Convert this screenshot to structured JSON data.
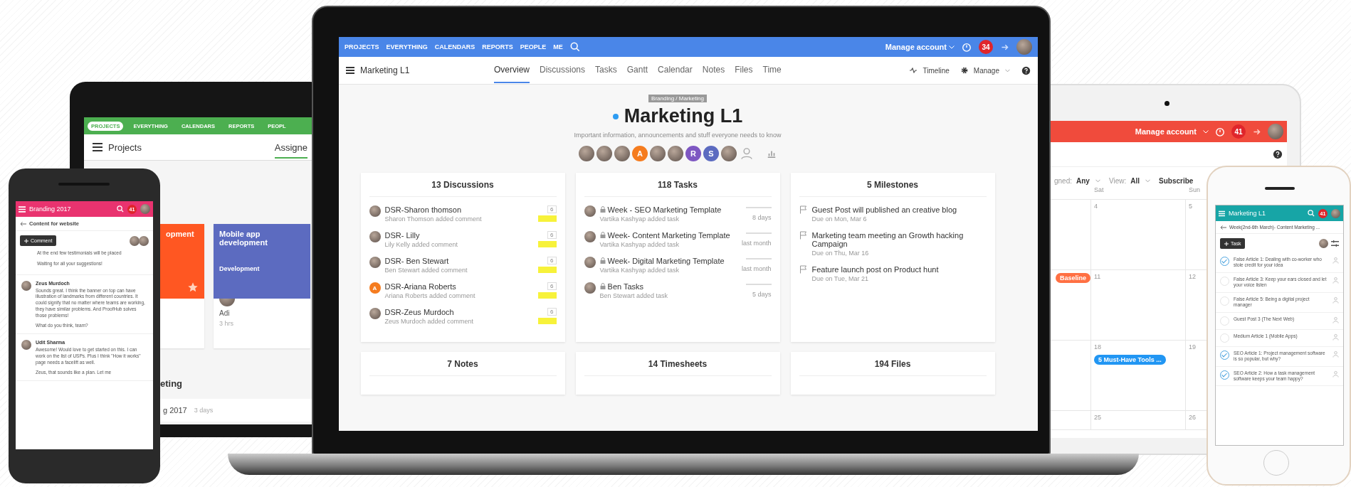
{
  "laptop": {
    "top_nav": [
      {
        "label": "PROJECTS"
      },
      {
        "label": "EVERYTHING"
      },
      {
        "label": "CALENDARS"
      },
      {
        "label": "REPORTS"
      },
      {
        "label": "PEOPLE"
      },
      {
        "label": "ME"
      }
    ],
    "account_menu": "Manage account",
    "notification_count": "34",
    "project_title": "Marketing L1",
    "tabs": [
      {
        "label": "Overview",
        "selected": true
      },
      {
        "label": "Discussions",
        "selected": false
      },
      {
        "label": "Tasks",
        "selected": false
      },
      {
        "label": "Gantt",
        "selected": false
      },
      {
        "label": "Calendar",
        "selected": false
      },
      {
        "label": "Notes",
        "selected": false
      },
      {
        "label": "Files",
        "selected": false
      },
      {
        "label": "Time",
        "selected": false
      }
    ],
    "timeline": "Timeline",
    "manage": "Manage",
    "breadcrumb": "Branding / Marketing",
    "title": "Marketing L1",
    "subtitle": "Important information, announcements and stuff everyone needs to know",
    "members": [
      {
        "kind": "photo"
      },
      {
        "kind": "photo"
      },
      {
        "kind": "photo"
      },
      {
        "kind": "letter",
        "letter": "A",
        "color": "#f57c1f"
      },
      {
        "kind": "photo"
      },
      {
        "kind": "photo"
      },
      {
        "kind": "letter",
        "letter": "R",
        "color": "#7e57c2"
      },
      {
        "kind": "letter",
        "letter": "S",
        "color": "#5c6bc0"
      },
      {
        "kind": "photo"
      },
      {
        "kind": "add"
      }
    ],
    "panels": [
      {
        "kind": "discussions",
        "title": "13 Discussions",
        "items": [
          {
            "name": "DSR-Sharon thomson",
            "activity": "Sharon Thomson added comment",
            "count": "6",
            "highlighted": true,
            "avatar": {
              "kind": "photo"
            }
          },
          {
            "name": "DSR- Lilly",
            "activity": "Lily Kelly added comment",
            "count": "6",
            "highlighted": true,
            "avatar": {
              "kind": "photo"
            }
          },
          {
            "name": "DSR- Ben Stewart",
            "activity": "Ben Stewart added comment",
            "count": "6",
            "highlighted": true,
            "avatar": {
              "kind": "photo"
            }
          },
          {
            "name": "DSR-Ariana Roberts",
            "activity": "Ariana Roberts added comment",
            "count": "6",
            "highlighted": true,
            "avatar": {
              "kind": "letter",
              "letter": "A",
              "color": "#f57c1f"
            }
          },
          {
            "name": "DSR-Zeus Murdoch",
            "activity": "Zeus Murdoch added comment",
            "count": "6",
            "highlighted": true,
            "avatar": {
              "kind": "photo"
            }
          }
        ]
      },
      {
        "kind": "tasks",
        "title": "118 Tasks",
        "items": [
          {
            "title": "Week - SEO Marketing Template",
            "activity": "Vartika Kashyap added task",
            "time": "8 days"
          },
          {
            "title": "Week- Content Marketing Template",
            "activity": "Vartika Kashyap added task",
            "time": "last month"
          },
          {
            "title": "Week- Digital Marketing Template",
            "activity": "Vartika Kashyap added task",
            "time": "last month"
          },
          {
            "title": "Ben Tasks",
            "activity": "Ben Stewart added task",
            "time": "5 days"
          }
        ]
      },
      {
        "kind": "milestones",
        "title": "5 Milestones",
        "items": [
          {
            "title": "Guest Post will published an creative blog",
            "due": "Due on Mon, Mar 6"
          },
          {
            "title": "Marketing team meeting an Growth hacking Campaign",
            "due": "Due on Thu, Mar 16"
          },
          {
            "title": "Feature launch post on Product hunt",
            "due": "Due on Tue, Mar 21"
          }
        ]
      }
    ],
    "more_panels": [
      {
        "title": "7 Notes"
      },
      {
        "title": "14 Timesheets"
      },
      {
        "title": "194 Files"
      }
    ]
  },
  "left_tablet": {
    "nav": [
      {
        "label": "PROJECTS",
        "selected": true
      },
      {
        "label": "EVERYTHING",
        "selected": false
      },
      {
        "label": "CALENDARS",
        "selected": false
      },
      {
        "label": "REPORTS",
        "selected": false
      },
      {
        "label": "PEOPL",
        "selected": false
      }
    ],
    "title": "Projects",
    "view_tab": "Assigne",
    "cards": [
      {
        "title": "opment",
        "color": "#ff5722",
        "starred": true
      },
      {
        "title": "Mobile app development",
        "color": "#5c6bc0",
        "starred": false,
        "tag": "Development",
        "assignee": "Adi",
        "time": "3 hrs"
      }
    ],
    "section_title": "eting",
    "row": {
      "name": "g 2017",
      "time": "3 days"
    }
  },
  "left_phone": {
    "title": "Branding 2017",
    "notification_count": "41",
    "back_title": "Content for website",
    "comment_button": "Comment",
    "intro": [
      "At the end few testimonials will be placed",
      "Waiting for all your suggestions!"
    ],
    "comments": [
      {
        "author": "Zeus Murdoch",
        "paragraphs": [
          "Sounds great. I think the banner on top can have illustration of landmarks from different countries. It could signify that no matter where teams are working, they have similar problems. And ProofHub solves those problems!",
          "What do you think, team?"
        ]
      },
      {
        "author": "Udit Sharma",
        "paragraphs": [
          "Awesome! Would love to get started on this. I can work on the list of USPs. Plus I think \"How it works\" page needs a facelift as well.",
          "Zeus, that sounds like a plan. Let me"
        ]
      }
    ]
  },
  "right_tablet": {
    "account_menu": "Manage account",
    "notification_count": "41",
    "filters": [
      {
        "label": "gned:",
        "value": "Any"
      },
      {
        "label": "View:",
        "value": "All"
      }
    ],
    "subscribe": "Subscribe",
    "days": [
      "Sat",
      "Sun"
    ],
    "weeks": [
      {
        "dates": [
          "4",
          "5"
        ]
      },
      {
        "dates": [
          "11",
          "12"
        ],
        "lead_event": {
          "label": "Baseline",
          "color": "#ff7043"
        }
      },
      {
        "dates": [
          "18",
          "19"
        ],
        "events": [
          {
            "label": "5 Must-Have Tools ...",
            "color": "#2196f3"
          }
        ]
      },
      {
        "dates": [
          "25",
          "26"
        ]
      }
    ]
  },
  "right_phone": {
    "title": "Marketing L1",
    "notification_count": "41",
    "back_title": "Week(2nd-6th March)- Content Marketing ...",
    "task_button": "Task",
    "tasks": [
      {
        "title": "False Article 1: Dealing with co-worker who stole credit for your idea",
        "checked": true
      },
      {
        "title": "False Article 3: Keep your ears closed and let your voice listen",
        "checked": false
      },
      {
        "title": "False Article 5: Being a digital project manager",
        "checked": false
      },
      {
        "title": "Guest Post 3 (The Next Web)",
        "checked": false
      },
      {
        "title": "Medium Article 1 (Mobile Apps)",
        "checked": false
      },
      {
        "title": "SEO Article 1: Project management software is so popular, but why?",
        "checked": true
      },
      {
        "title": "SEO Article 2: How a task management software keeps your team happy?",
        "checked": true
      }
    ]
  }
}
